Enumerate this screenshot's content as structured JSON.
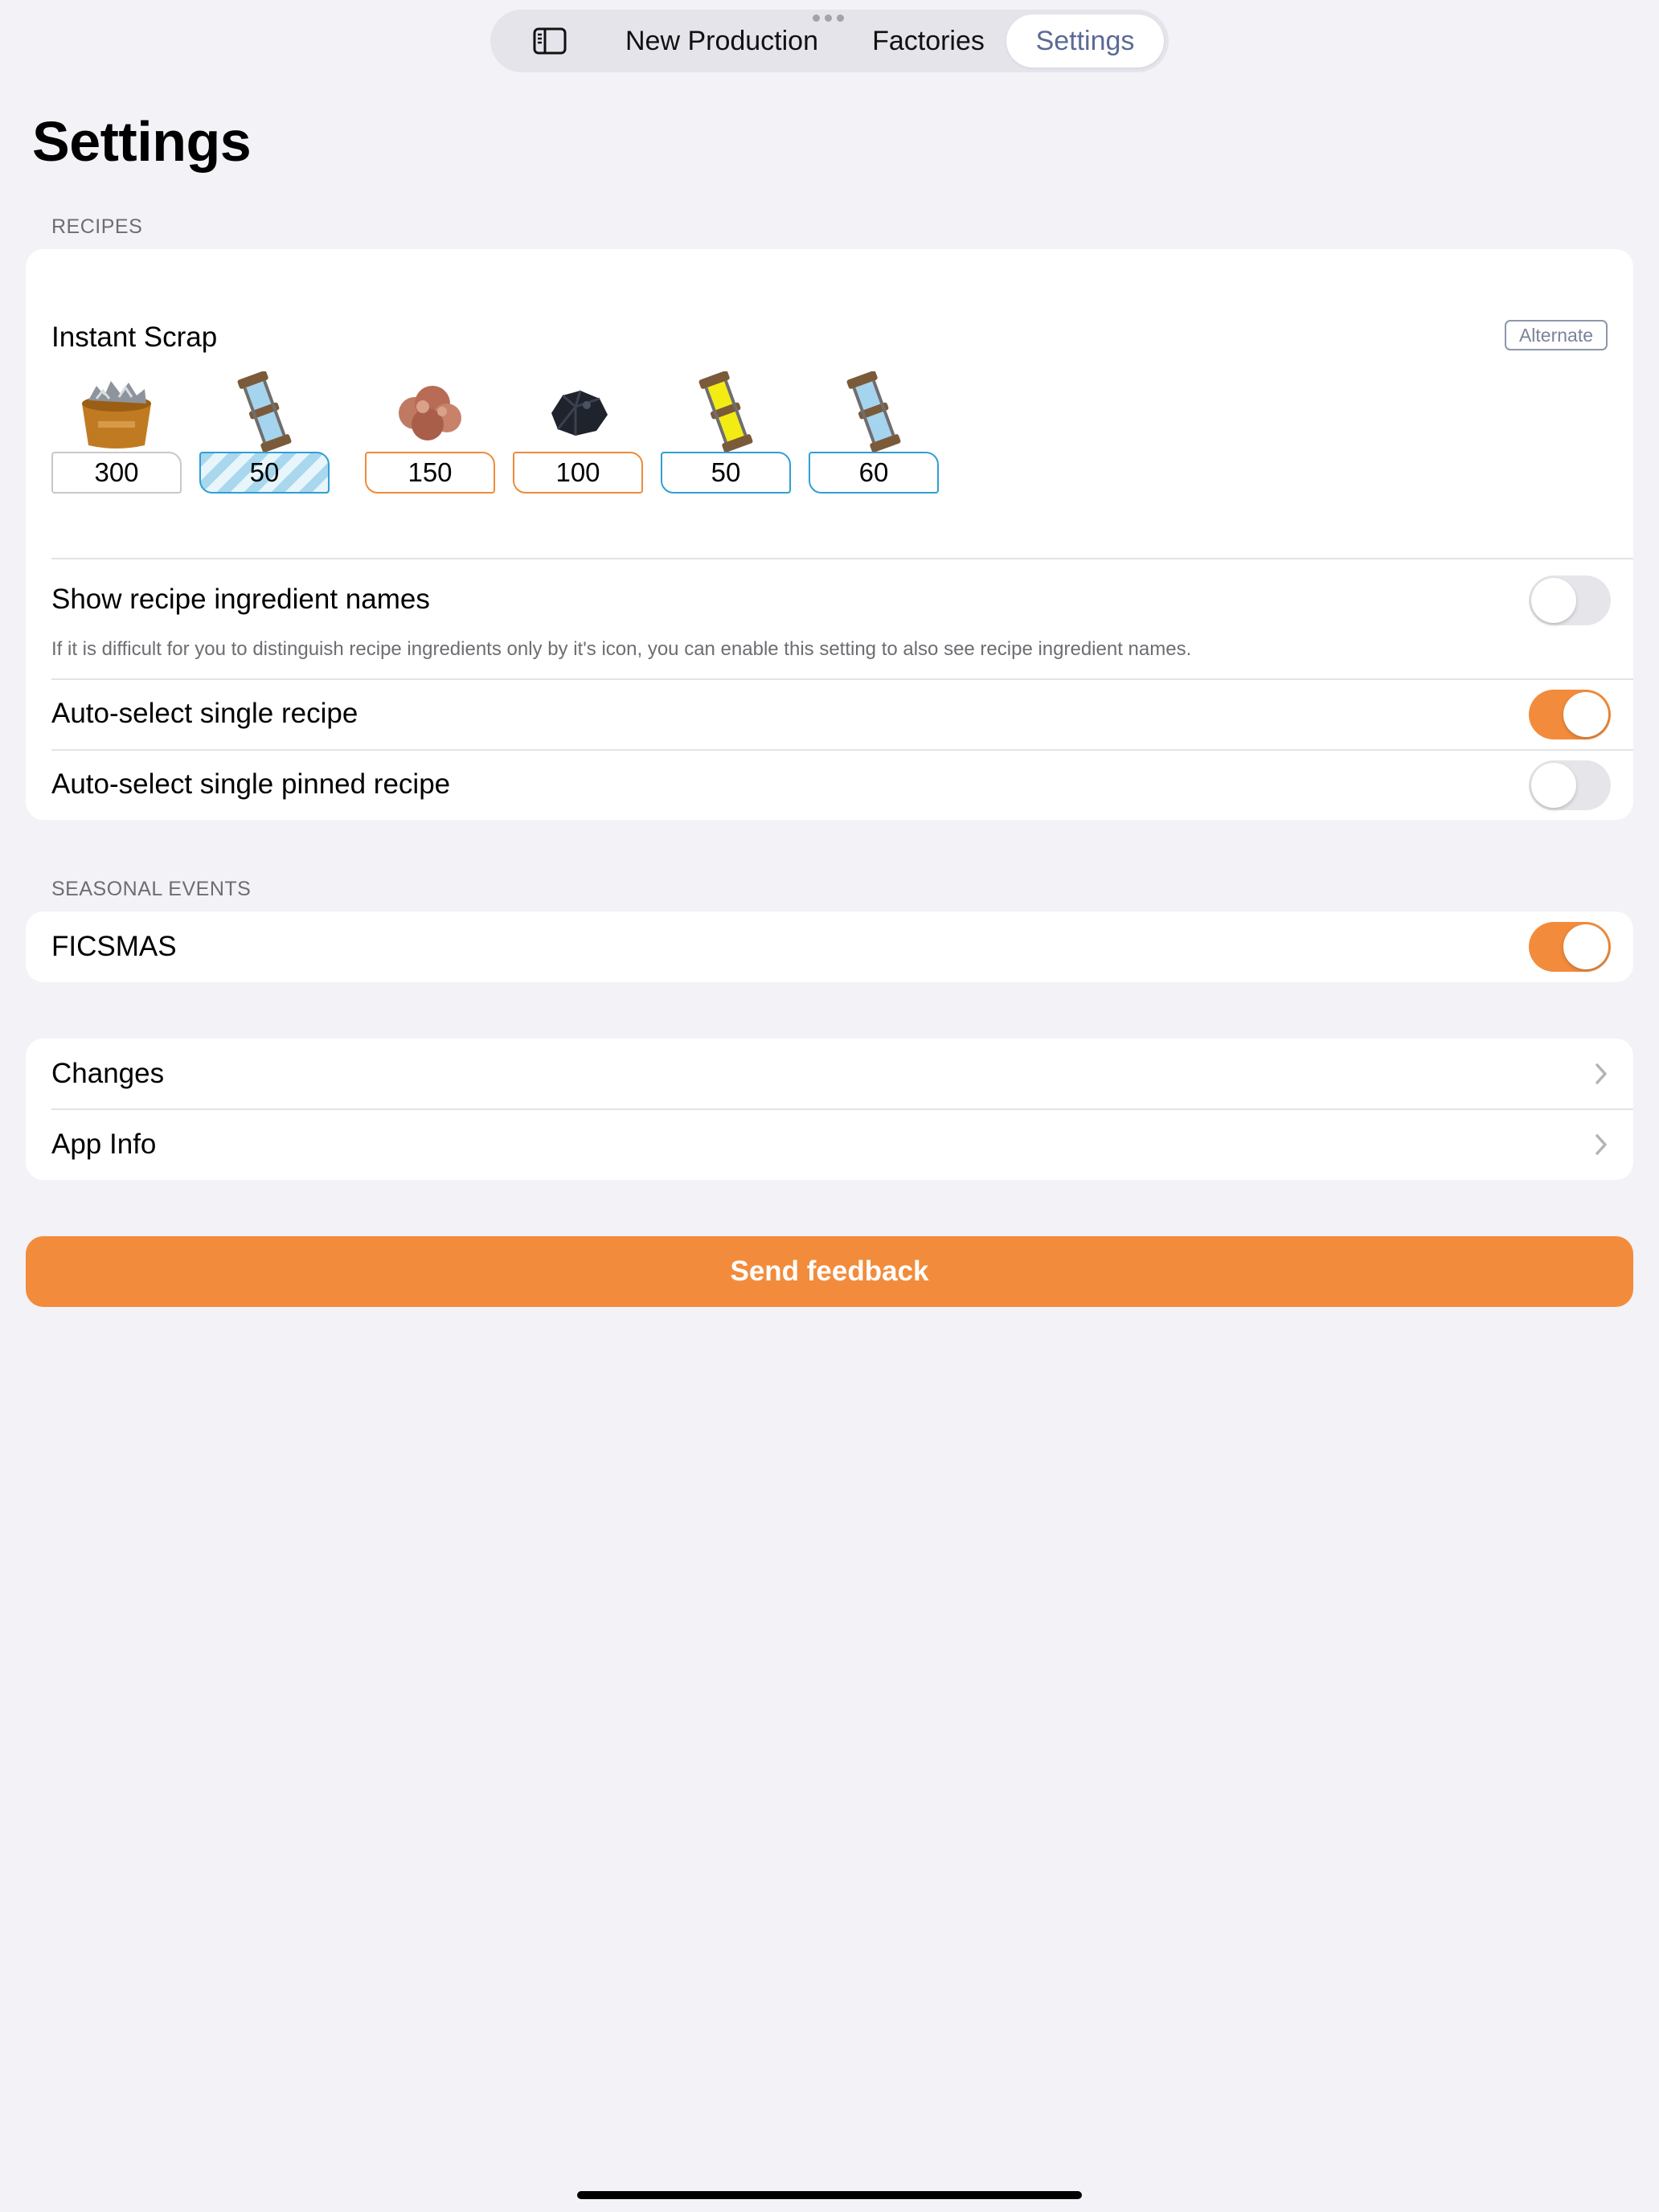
{
  "nav": {
    "sidebar_icon": "sidebar-icon",
    "tabs": [
      {
        "label": "New Production",
        "selected": false
      },
      {
        "label": "Factories",
        "selected": false
      },
      {
        "label": "Settings",
        "selected": true
      }
    ]
  },
  "page_title": "Settings",
  "recipes_section": {
    "header": "RECIPES",
    "recipe": {
      "name": "Instant Scrap",
      "badge": "Alternate",
      "ingredients": [
        {
          "icon": "scrap-bucket-icon",
          "amount": "300"
        },
        {
          "icon": "water-canister-icon",
          "amount": "50"
        },
        {
          "icon": "bauxite-ore-icon",
          "amount": "150"
        },
        {
          "icon": "coal-icon",
          "amount": "100"
        },
        {
          "icon": "sulfuric-acid-canister-icon",
          "amount": "50"
        },
        {
          "icon": "water-canister-icon",
          "amount": "60"
        }
      ]
    },
    "show_names": {
      "label": "Show recipe ingredient names",
      "enabled": false,
      "footnote": "If it is difficult for you to distinguish recipe ingredients only by it's icon, you can enable this setting to also see recipe ingredient names."
    },
    "auto_select_single": {
      "label": "Auto-select single recipe",
      "enabled": true
    },
    "auto_select_pinned": {
      "label": "Auto-select single pinned recipe",
      "enabled": false
    }
  },
  "seasonal_section": {
    "header": "SEASONAL EVENTS",
    "ficsmas": {
      "label": "FICSMAS",
      "enabled": true
    }
  },
  "links": [
    {
      "label": "Changes"
    },
    {
      "label": "App Info"
    }
  ],
  "feedback_button": "Send feedback",
  "colors": {
    "accent": "#f28c3c",
    "selected_tab_text": "#5b6a96",
    "background": "#f2f2f7"
  }
}
